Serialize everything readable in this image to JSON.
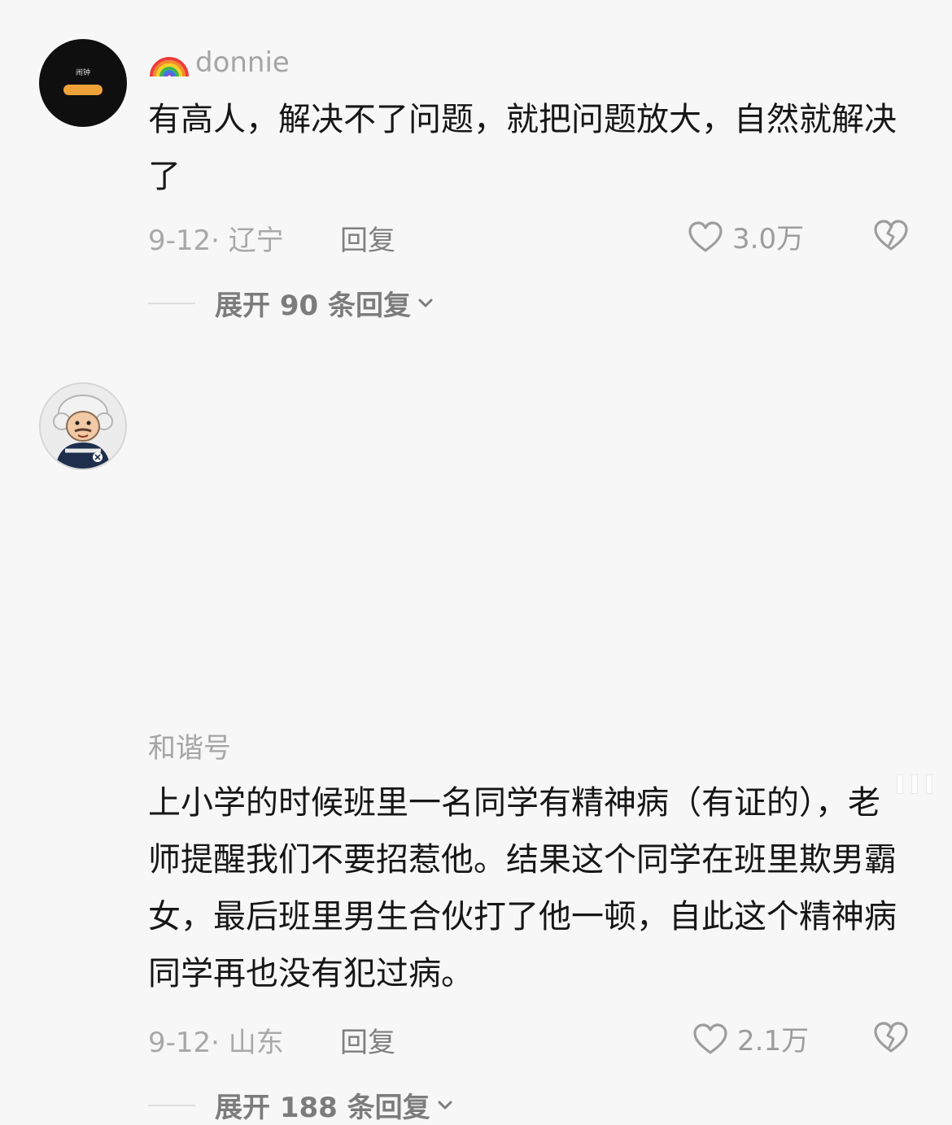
{
  "comments": [
    {
      "username": "donnie",
      "avatar_text": "闹钟",
      "text": "有高人，解决不了问题，就把问题放大，自然就解决了",
      "date_location": "9-12· 辽宁",
      "reply_label": "回复",
      "likes": "3.0万",
      "expand_label": "展开 90 条回复"
    },
    {
      "username": "和谐号",
      "text": "上小学的时候班里一名同学有精神病（有证的），老师提醒我们不要招惹他。结果这个同学在班里欺男霸女，最后班里男生合伙打了他一顿，自此这个精神病同学再也没有犯过病。",
      "date_location": "9-12· 山东",
      "reply_label": "回复",
      "likes": "2.1万",
      "expand_label": "展开 188 条回复"
    }
  ],
  "icons": {
    "like": "heart-outline-icon",
    "dislike": "broken-heart-icon",
    "expand": "chevron-down-icon",
    "username_prefix": "rainbow-icon"
  }
}
